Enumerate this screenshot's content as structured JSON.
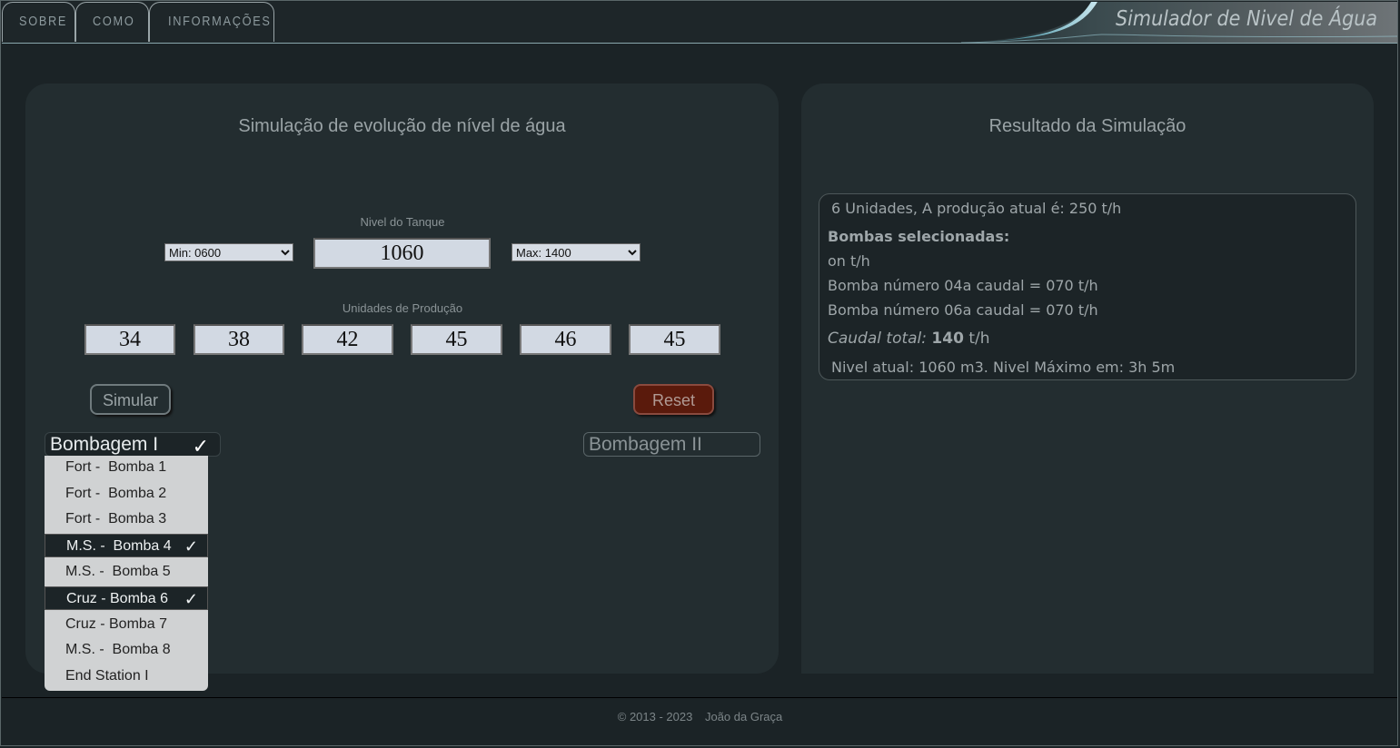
{
  "nav": {
    "tabs": [
      "SOBRE",
      "COMO",
      "INFORMAÇÕES"
    ],
    "app_title": "Simulador de Nivel  de Água"
  },
  "left": {
    "title": "Simulação de evolução de nível de água",
    "tank_label": "Nivel do Tanque",
    "min_select": "Min: 0600",
    "tank_level": "1060",
    "max_select": "Max: 1400",
    "units_label": "Unidades de Produção",
    "units": [
      "34",
      "38",
      "42",
      "45",
      "46",
      "45"
    ],
    "simulate_button": "Simular",
    "reset_button": "Reset",
    "bombagem1": {
      "label": "Bombagem I",
      "check": "✓",
      "items": [
        {
          "label": "Fort -  Bomba 1",
          "selected": false
        },
        {
          "label": "Fort -  Bomba 2",
          "selected": false
        },
        {
          "label": "Fort -  Bomba 3",
          "selected": false
        },
        {
          "label": "M.S. -  Bomba 4",
          "selected": true
        },
        {
          "label": "M.S. -  Bomba 5",
          "selected": false
        },
        {
          "label": "Cruz - Bomba 6",
          "selected": true
        },
        {
          "label": "Cruz - Bomba 7",
          "selected": false
        },
        {
          "label": "M.S. -  Bomba 8",
          "selected": false
        },
        {
          "label": "End Station I",
          "selected": false
        }
      ]
    },
    "bombagem2": {
      "label": "Bombagem II"
    }
  },
  "right": {
    "title": "Resultado da Simulação",
    "production_line": "6 Unidades, A produção atual é: 250 t/h",
    "selected_heading": "Bombas selecionadas:",
    "on_line": "on t/h",
    "pump_lines": [
      "Bomba número 04a caudal = 070 t/h",
      "Bomba número 06a caudal = 070 t/h"
    ],
    "total_label": "Caudal total:",
    "total_value": "140",
    "total_unit": "t/h",
    "level_line": "Nivel atual: 1060 m3. Nivel Máximo em: 3h 5m"
  },
  "footer": {
    "copyright": "© 2013 - 2023",
    "author": "João da Graça"
  },
  "colors": {
    "background": "#1b2326",
    "panel": "#232d30",
    "reset_button": "#5a1a0c",
    "input_bg": "#d2d9e3"
  }
}
